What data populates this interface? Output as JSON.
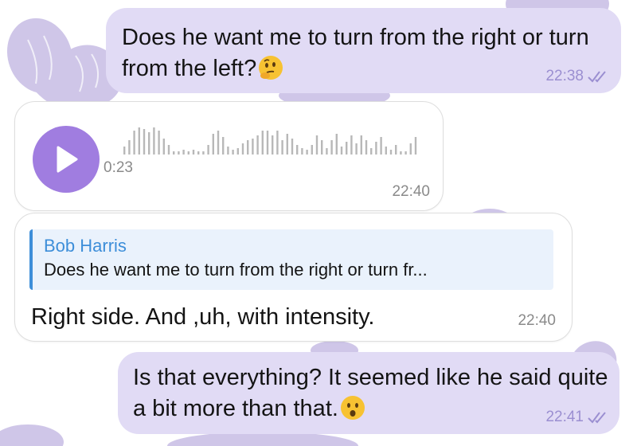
{
  "messages": [
    {
      "direction": "outgoing",
      "text": "Does he want me to turn from the right or turn from the left?",
      "emoji": "thinking-face",
      "time": "22:38",
      "status": "read"
    },
    {
      "direction": "incoming",
      "type": "voice",
      "duration": "0:23",
      "time": "22:40"
    },
    {
      "direction": "incoming",
      "reply_to": {
        "name": "Bob Harris",
        "text": "Does he want me to turn from the right or turn fr..."
      },
      "text": "Right side. And ,uh, with intensity.",
      "time": "22:40"
    },
    {
      "direction": "outgoing",
      "text": "Is that everything? It seemed like he said quite a bit more than that.",
      "emoji": "hushed-face",
      "time": "22:41",
      "status": "read"
    }
  ],
  "colors": {
    "outgoing_bubble": "#e1dbf5",
    "incoming_bubble": "#ffffff",
    "accent_purple": "#a07de0",
    "reply_blue": "#3d8ed9",
    "time_outgoing": "#9b8fd1",
    "time_incoming": "#8a8a8a"
  }
}
